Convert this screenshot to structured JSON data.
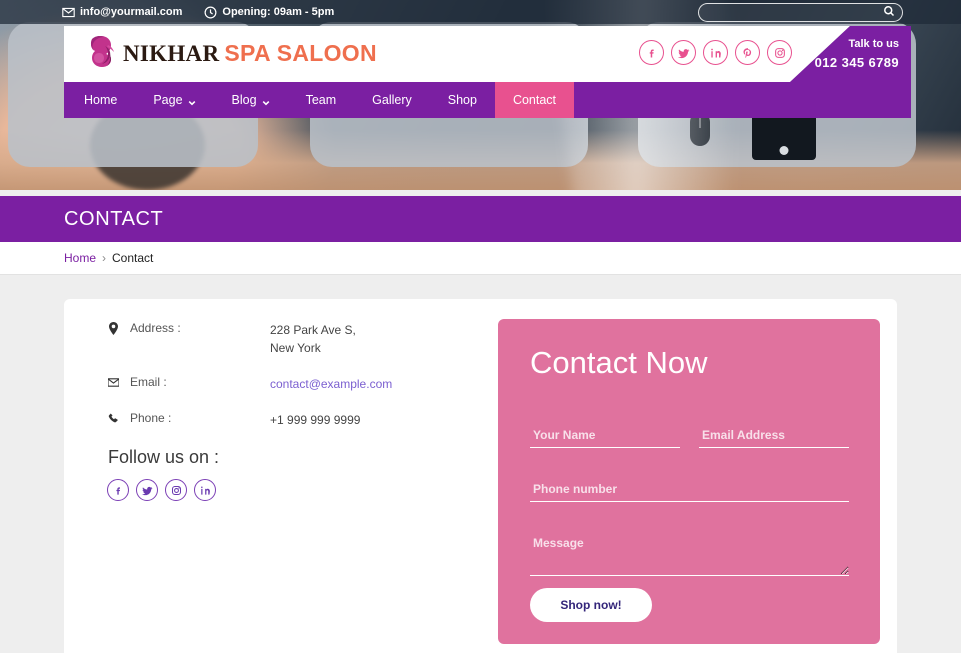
{
  "topbar": {
    "email": "info@yourmail.com",
    "hours": "Opening: 09am - 5pm",
    "search_placeholder": "",
    "search_value": ""
  },
  "header": {
    "logo_primary": "NIKHAR",
    "logo_secondary": "SPA SALOON",
    "talk_label": "Talk to us",
    "talk_number": "012 345 6789",
    "social": [
      {
        "name": "facebook",
        "label": "Facebook"
      },
      {
        "name": "twitter",
        "label": "Twitter"
      },
      {
        "name": "linkedin",
        "label": "LinkedIn"
      },
      {
        "name": "pinterest",
        "label": "Pinterest"
      },
      {
        "name": "instagram",
        "label": "Instagram"
      }
    ]
  },
  "nav": {
    "items": [
      {
        "label": "Home",
        "has_caret": false,
        "active": false
      },
      {
        "label": "Page",
        "has_caret": true,
        "active": false
      },
      {
        "label": "Blog",
        "has_caret": true,
        "active": false
      },
      {
        "label": "Team",
        "has_caret": false,
        "active": false
      },
      {
        "label": "Gallery",
        "has_caret": false,
        "active": false
      },
      {
        "label": "Shop",
        "has_caret": false,
        "active": false
      },
      {
        "label": "Contact",
        "has_caret": false,
        "active": true
      }
    ]
  },
  "page_header": {
    "title": "CONTACT",
    "breadcrumb_home": "Home",
    "breadcrumb_separator": "›",
    "breadcrumb_current": "Contact"
  },
  "contact_info": {
    "rows": [
      {
        "icon": "map-pin-icon",
        "label": "Address :",
        "value": "228 Park Ave S,\nNew York",
        "is_link": false
      },
      {
        "icon": "envelope-icon",
        "label": "Email :",
        "value": "contact@example.com",
        "is_link": true
      },
      {
        "icon": "phone-icon",
        "label": "Phone :",
        "value": "+1 999 999 9999",
        "is_link": false
      }
    ],
    "follow_title": "Follow us on :",
    "follow_social": [
      {
        "name": "facebook",
        "label": "Facebook"
      },
      {
        "name": "twitter",
        "label": "Twitter"
      },
      {
        "name": "instagram",
        "label": "Instagram"
      },
      {
        "name": "linkedin",
        "label": "LinkedIn"
      }
    ]
  },
  "form": {
    "title": "Contact Now",
    "name_placeholder": "Your Name",
    "name_value": "",
    "email_placeholder": "Email Address",
    "email_value": "",
    "phone_placeholder": "Phone number",
    "phone_value": "",
    "message_placeholder": "Message",
    "message_value": "",
    "submit_label": "Shop now!"
  },
  "colors": {
    "purple": "#7b1fa2",
    "pink": "#e8518f",
    "form_pink": "#e0729e",
    "orange": "#ef6f4e",
    "link_purple": "#7b5fd0"
  }
}
